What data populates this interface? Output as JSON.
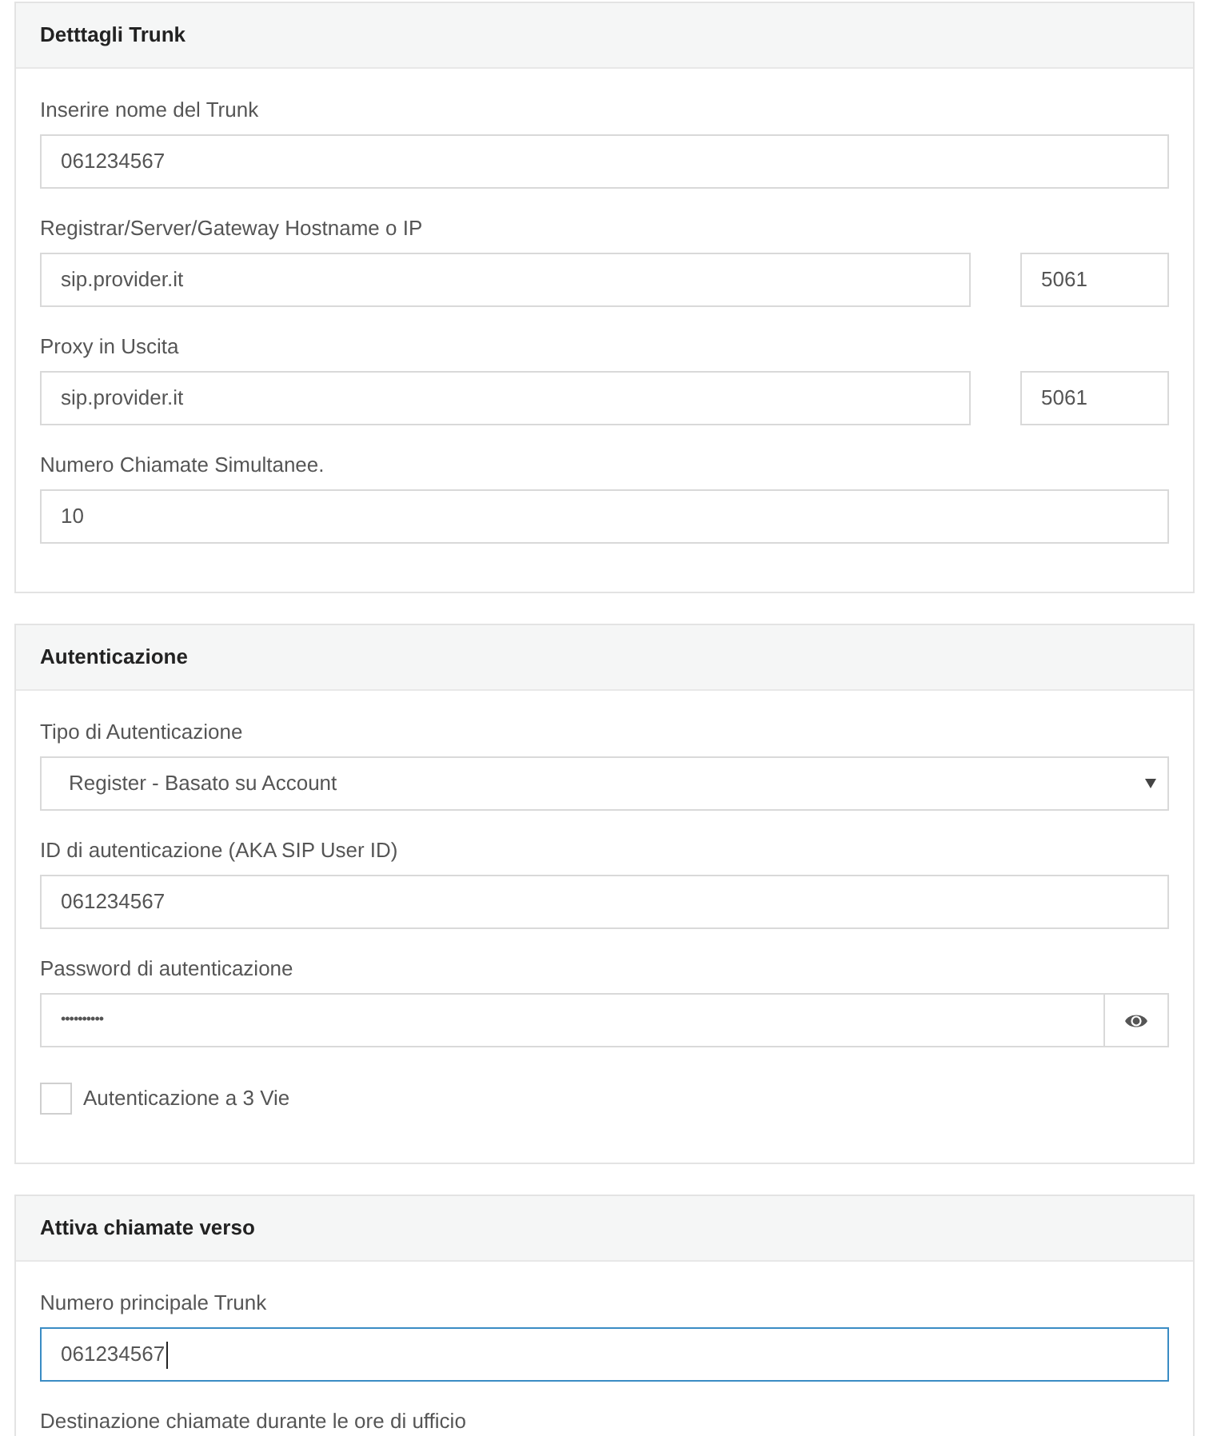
{
  "sections": [
    {
      "title": "Detttagli Trunk",
      "fields": [
        {
          "kind": "text",
          "label": "Inserire nome del Trunk",
          "value": "061234567",
          "focused": false
        },
        {
          "kind": "host_port",
          "label": "Registrar/Server/Gateway Hostname o IP",
          "value": "sip.provider.it",
          "port": "5061",
          "focused": false
        },
        {
          "kind": "host_port",
          "label": "Proxy in Uscita",
          "value": "sip.provider.it",
          "port": "5061",
          "focused": false
        },
        {
          "kind": "text",
          "label": "Numero Chiamate Simultanee.",
          "value": "10",
          "focused": false
        }
      ]
    },
    {
      "title": "Autenticazione",
      "fields": [
        {
          "kind": "select",
          "label": "Tipo di Autenticazione",
          "value": "Register - Basato su Account",
          "focused": false
        },
        {
          "kind": "text",
          "label": "ID di autenticazione (AKA SIP User ID)",
          "value": "061234567",
          "focused": false
        },
        {
          "kind": "password",
          "label": "Password di autenticazione",
          "value": "••••••••••",
          "focused": false
        },
        {
          "kind": "checkbox",
          "label": "Autenticazione a 3 Vie",
          "checked": false
        }
      ]
    },
    {
      "title": "Attiva chiamate verso",
      "fields": [
        {
          "kind": "text",
          "label": "Numero principale Trunk",
          "value": "061234567",
          "focused": true
        },
        {
          "kind": "label_only",
          "label": "Destinazione chiamate durante le ore di ufficio"
        }
      ]
    }
  ]
}
